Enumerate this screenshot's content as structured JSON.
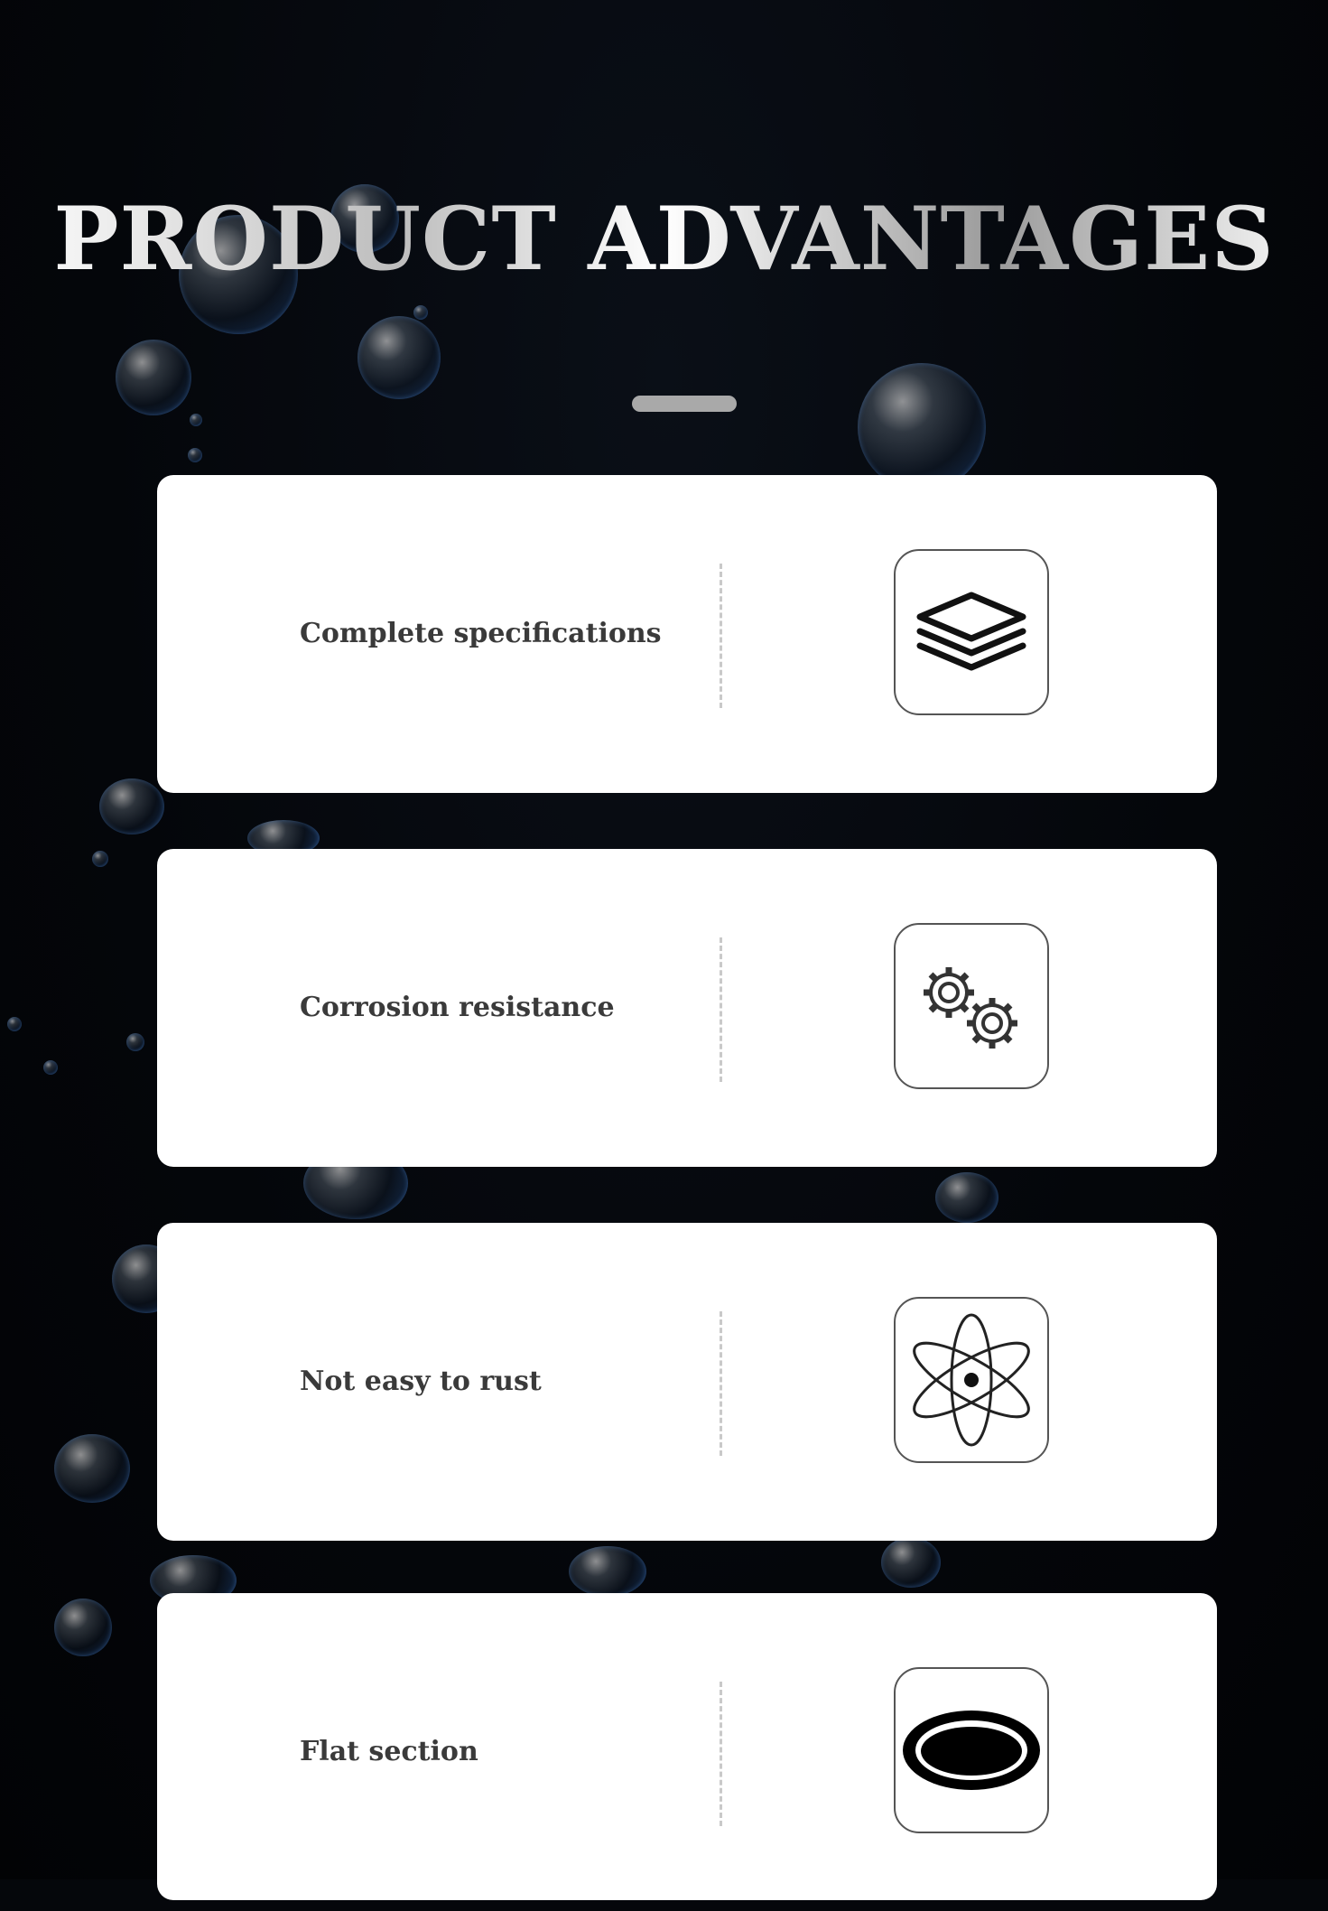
{
  "header": {
    "title": "PRODUCT ADVANTAGES"
  },
  "advantages": [
    {
      "label": "Complete specifications",
      "icon": "layers-icon"
    },
    {
      "label": "Corrosion resistance",
      "icon": "gears-icon"
    },
    {
      "label": "Not easy to rust",
      "icon": "atom-icon"
    },
    {
      "label": "Flat section",
      "icon": "flat-ring-icon"
    }
  ],
  "colors": {
    "background": "#05070b",
    "card": "#ffffff",
    "label_text": "#3a3a3a",
    "accent_bar": "#a9a9a9",
    "bubble_tint": "#3a78c8"
  }
}
